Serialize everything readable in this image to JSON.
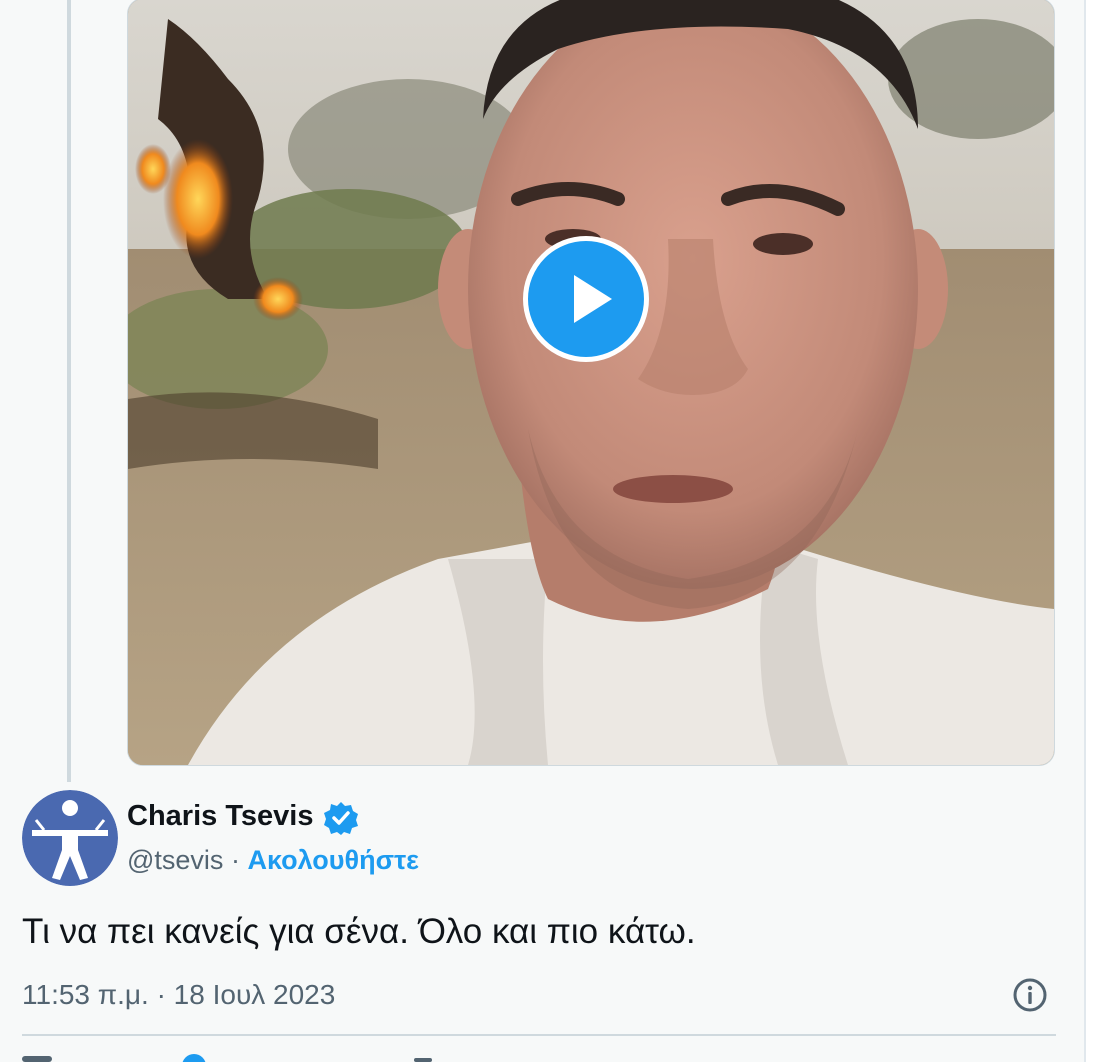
{
  "video": {
    "play_label": "Play video"
  },
  "author": {
    "name": "Charis Tsevis",
    "handle": "@tsevis",
    "separator": "·",
    "follow_label": "Ακολουθήστε",
    "verified": true
  },
  "tweet": {
    "text": "Τι να πει κανείς για σένα. Όλο και πιο κάτω.",
    "time": "11:53 π.μ.",
    "date_separator": "·",
    "date": "18 Ιουλ 2023"
  },
  "icons": {
    "verified": "verified-badge-icon",
    "info": "info-icon",
    "play": "play-icon"
  },
  "colors": {
    "accent": "#1d9bf0",
    "text": "#0f1419",
    "muted": "#536471",
    "avatar_bg": "#4a69b0"
  }
}
